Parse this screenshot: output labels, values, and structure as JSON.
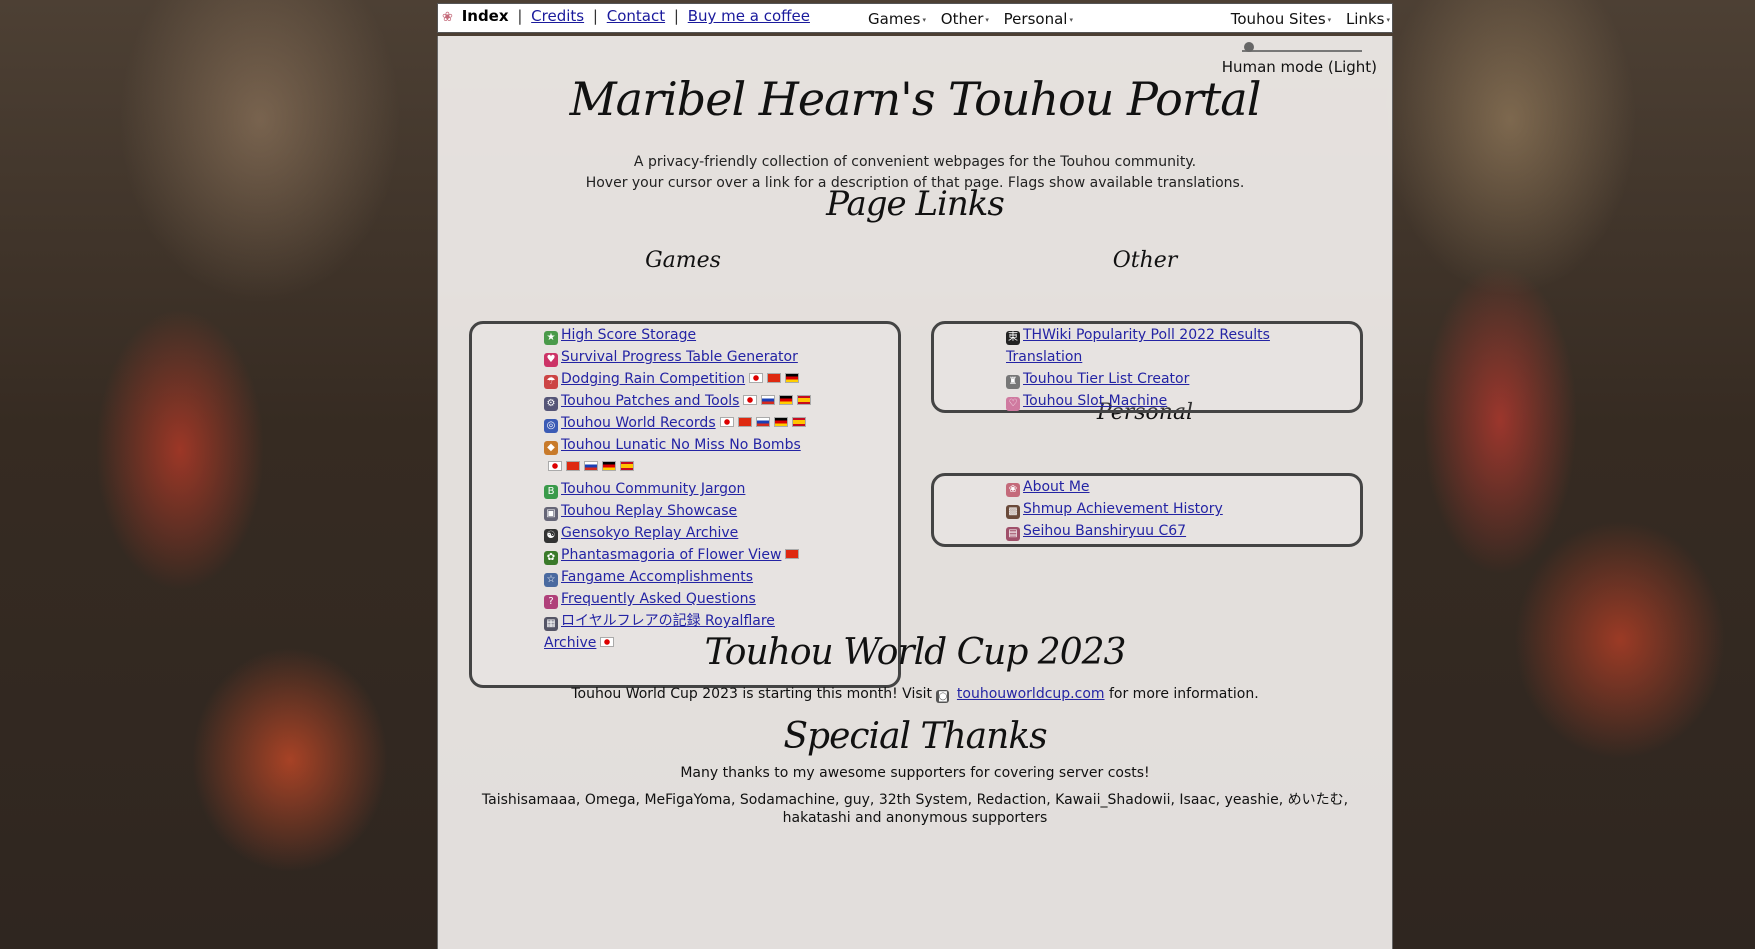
{
  "nav": {
    "logo_glyph": "❀",
    "index": "Index",
    "sep": "|",
    "credits": "Credits",
    "contact": "Contact",
    "coffee": "Buy me a coffee",
    "menu_center": [
      "Games",
      "Other",
      "Personal"
    ],
    "menu_right": [
      "Touhou Sites",
      "Links"
    ],
    "caret": "▾"
  },
  "mode": {
    "label": "Human mode (Light)"
  },
  "header": {
    "title": "Maribel Hearn's Touhou Portal",
    "line1": "A privacy-friendly collection of convenient webpages for the Touhou community.",
    "line2": "Hover your cursor over a link for a description of that page. Flags show available translations."
  },
  "page_links": {
    "heading": "Page Links",
    "games": {
      "heading": "Games",
      "items": [
        {
          "label": "High Score Storage",
          "icon": "star-icon",
          "icon_char": "★",
          "icon_color": "#4a9a4a",
          "flags": []
        },
        {
          "label": "Survival Progress Table Generator",
          "icon": "heart-icon",
          "icon_char": "♥",
          "icon_color": "#cc3366",
          "flags": []
        },
        {
          "label": "Dodging Rain Competition",
          "icon": "rain-icon",
          "icon_char": "☂",
          "icon_color": "#c44",
          "flags": [
            "jp",
            "cn",
            "de"
          ]
        },
        {
          "label": "Touhou Patches and Tools",
          "icon": "tools-icon",
          "icon_char": "⚙",
          "icon_color": "#557",
          "flags": [
            "jp",
            "ru",
            "de",
            "es"
          ]
        },
        {
          "label": "Touhou World Records",
          "icon": "record-icon",
          "icon_char": "◎",
          "icon_color": "#3b5bb5",
          "flags": [
            "jp",
            "cn",
            "ru",
            "de",
            "es"
          ]
        },
        {
          "label": "Touhou Lunatic No Miss No Bombs",
          "icon": "lnn-icon",
          "icon_char": "◆",
          "icon_color": "#c87a2a",
          "flags": [
            "jp",
            "cn",
            "ru",
            "de",
            "es"
          ]
        },
        {
          "label": "Touhou Community Jargon",
          "icon": "jargon-icon",
          "icon_char": "B",
          "icon_color": "#3a9a4a",
          "flags": []
        },
        {
          "label": "Touhou Replay Showcase",
          "icon": "replay-icon",
          "icon_char": "▣",
          "icon_color": "#667",
          "flags": []
        },
        {
          "label": "Gensokyo Replay Archive",
          "icon": "yinyang-icon",
          "icon_char": "☯",
          "icon_color": "#333",
          "flags": []
        },
        {
          "label": "Phantasmagoria of Flower View",
          "icon": "flower-icon",
          "icon_char": "✿",
          "icon_color": "#3a7a2a",
          "flags": [
            "cn"
          ]
        },
        {
          "label": "Fangame Accomplishments",
          "icon": "fangame-icon",
          "icon_char": "☆",
          "icon_color": "#4a6aa0",
          "flags": []
        },
        {
          "label": "Frequently Asked Questions",
          "icon": "faq-icon",
          "icon_char": "?",
          "icon_color": "#b0407a",
          "flags": []
        },
        {
          "label": "ロイヤルフレアの記録 Royalflare Archive",
          "icon": "royalflare-icon",
          "icon_char": "▦",
          "icon_color": "#556",
          "flags": [
            "jp"
          ]
        }
      ]
    },
    "other": {
      "heading": "Other",
      "items": [
        {
          "label": "THWiki Popularity Poll 2022 Results Translation",
          "icon": "thwiki-icon",
          "icon_char": "東",
          "icon_color": "#222",
          "flags": []
        },
        {
          "label": "Touhou Tier List Creator",
          "icon": "tier-icon",
          "icon_char": "♜",
          "icon_color": "#777",
          "flags": []
        },
        {
          "label": "Touhou Slot Machine",
          "icon": "slot-icon",
          "icon_char": "♡",
          "icon_color": "#d07aa0",
          "flags": []
        }
      ]
    },
    "personal": {
      "heading": "Personal",
      "items": [
        {
          "label": "About Me",
          "icon": "sakura-icon",
          "icon_char": "❀",
          "icon_color": "#c46a7a",
          "flags": []
        },
        {
          "label": "Shmup Achievement History",
          "icon": "achievement-icon",
          "icon_char": "▩",
          "icon_color": "#6a4a3a",
          "flags": []
        },
        {
          "label": "Seihou Banshiryuu C67",
          "icon": "seihou-icon",
          "icon_char": "▤",
          "icon_color": "#a0506a",
          "flags": []
        }
      ]
    }
  },
  "world_cup": {
    "heading": "Touhou World Cup 2023",
    "before": "Touhou World Cup 2023 is starting this month! Visit",
    "link": "touhouworldcup.com",
    "after": "for more information."
  },
  "thanks": {
    "heading": "Special Thanks",
    "line1": "Many thanks to my awesome supporters for covering server costs!",
    "line2": "Taishisamaaa, Omega, MeFigaYoma, Sodamachine, guy, 32th System, Redaction, Kawaii_Shadowii, Isaac, yeashie, めいたむ, hakatashi and anonymous supporters"
  }
}
